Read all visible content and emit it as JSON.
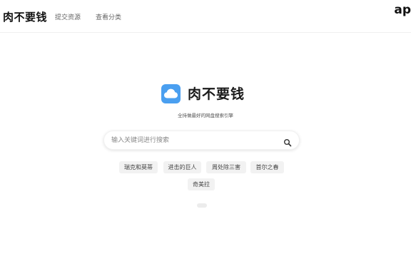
{
  "header": {
    "brand": "肉不要钱",
    "nav": [
      {
        "label": "提交资源"
      },
      {
        "label": "查看分类"
      }
    ],
    "corner_text": "ap"
  },
  "hero": {
    "logo_icon": "cloud-icon",
    "title": "肉不要钱",
    "slogan": "全持做最好的网盘搜索引擎",
    "accent_color": "#4a9ff0"
  },
  "search": {
    "value": "",
    "placeholder": "输入关键词进行搜索",
    "button_icon": "search-icon"
  },
  "tags": [
    {
      "label": "瑞克和莫蒂"
    },
    {
      "label": "进击的巨人"
    },
    {
      "label": "周处除三害"
    },
    {
      "label": "首尔之春"
    },
    {
      "label": "奇美拉"
    }
  ]
}
